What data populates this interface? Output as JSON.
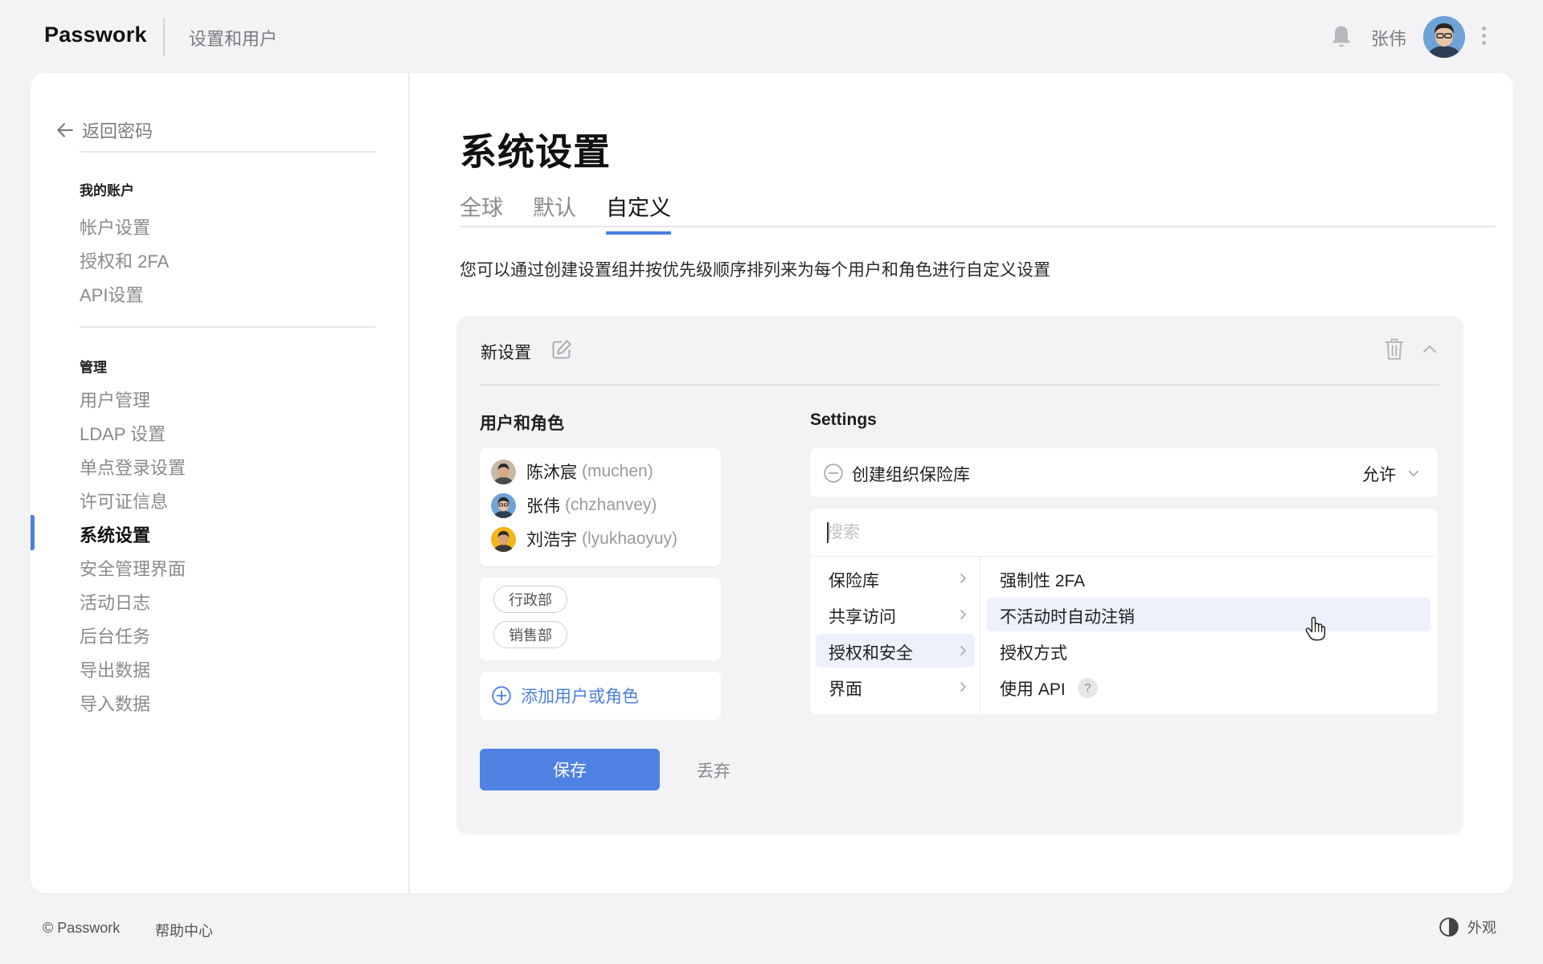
{
  "topbar": {
    "brand": "Passwork",
    "section": "设置和用户",
    "user_name": "张伟",
    "icons": {
      "bell": "bell-icon",
      "menu": "kebab-menu-icon"
    }
  },
  "sidebar": {
    "back_label": "返回密码",
    "account_heading": "我的账户",
    "account_items": [
      "帐户设置",
      "授权和 2FA",
      "API设置"
    ],
    "admin_heading": "管理",
    "admin_items": [
      "用户管理",
      "LDAP 设置",
      "单点登录设置",
      "许可证信息",
      "系统设置",
      "安全管理界面",
      "活动日志",
      "后台任务",
      "导出数据",
      "导入数据"
    ],
    "active_item": "系统设置"
  },
  "main": {
    "title": "系统设置",
    "tabs": [
      "全球",
      "默认",
      "自定义"
    ],
    "active_tab": "自定义",
    "description": "您可以通过创建设置组并按优先级顺序排列来为每个用户和角色进行自定义设置",
    "group": {
      "name": "新设置",
      "users_heading": "用户和角色",
      "settings_heading": "Settings",
      "users": [
        {
          "name": "陈沐宸",
          "login": "(muchen)"
        },
        {
          "name": "张伟",
          "login": "(chzhanvey)"
        },
        {
          "name": "刘浩宇",
          "login": "(lyukhaoyuy)"
        }
      ],
      "roles": [
        "行政部",
        "销售部"
      ],
      "add_label": "添加用户或角色",
      "permission": {
        "label": "创建组织保险库",
        "value": "允许"
      },
      "search_placeholder": "搜索",
      "categories": [
        "保险库",
        "共享访问",
        "授权和安全",
        "界面"
      ],
      "active_category": "授权和安全",
      "options": [
        "强制性 2FA",
        "不活动时自动注销",
        "授权方式",
        "使用 API"
      ],
      "hovered_option": "不活动时自动注销",
      "help_mark": "?"
    },
    "save_label": "保存",
    "discard_label": "丢弃"
  },
  "footer": {
    "copyright": "© Passwork",
    "help": "帮助中心",
    "appearance": "外观"
  },
  "colors": {
    "accent": "#4a7fe0",
    "save_button": "#4f82e3",
    "selection": "#edf1fb",
    "background": "#f3f3f5"
  }
}
